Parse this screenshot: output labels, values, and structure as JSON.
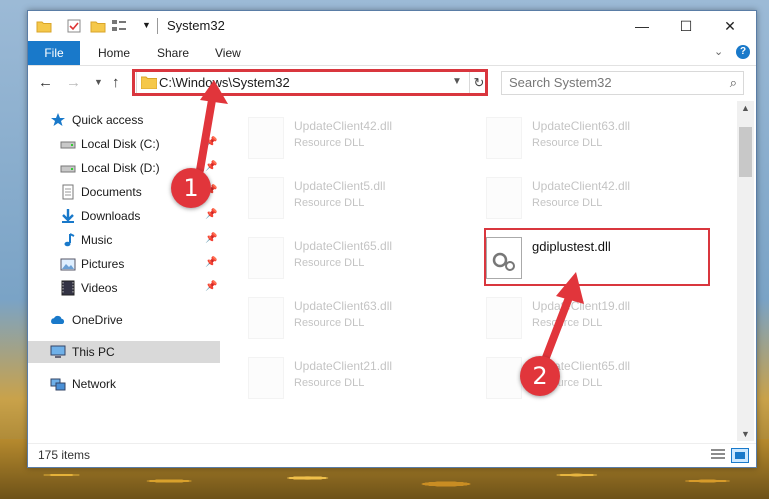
{
  "window": {
    "title": "System32"
  },
  "ribbon": {
    "tabs": [
      "File",
      "Home",
      "Share",
      "View"
    ],
    "help": "?"
  },
  "window_controls": {
    "minimize": "—",
    "maximize": "☐",
    "close": "✕"
  },
  "address": {
    "path": "C:\\Windows\\System32",
    "dropdown": "⌵",
    "refresh": "↻"
  },
  "search": {
    "placeholder": "Search System32",
    "icon": "⌕"
  },
  "nav_buttons": {
    "back": "←",
    "forward": "→",
    "recent": "⌵",
    "up": "↑"
  },
  "sidebar": {
    "items": [
      {
        "label": "Quick access",
        "icon": "star-icon",
        "pinned": false
      },
      {
        "label": "Local Disk (C:)",
        "icon": "drive-icon",
        "pinned": true
      },
      {
        "label": "Local Disk (D:)",
        "icon": "drive-icon",
        "pinned": true
      },
      {
        "label": "Documents",
        "icon": "documents-icon",
        "pinned": true
      },
      {
        "label": "Downloads",
        "icon": "download-icon",
        "pinned": true
      },
      {
        "label": "Music",
        "icon": "music-icon",
        "pinned": true
      },
      {
        "label": "Pictures",
        "icon": "pictures-icon",
        "pinned": true
      },
      {
        "label": "Videos",
        "icon": "videos-icon",
        "pinned": true
      },
      {
        "label": "OneDrive",
        "icon": "cloud-icon",
        "pinned": false
      },
      {
        "label": "This PC",
        "icon": "computer-icon",
        "pinned": false
      },
      {
        "label": "Network",
        "icon": "network-icon",
        "pinned": false
      }
    ],
    "pin_glyph": "📌"
  },
  "files": [
    {
      "name": "UpdateClient42.dll",
      "type": "Resource DLL"
    },
    {
      "name": "UpdateClient63.dll",
      "type": "Resource DLL"
    },
    {
      "name": "UpdateClient5.dll",
      "type": "Resource DLL"
    },
    {
      "name": "UpdateClient42.dll",
      "type": "Resource DLL"
    },
    {
      "name": "UpdateClient65.dll",
      "type": "Resource DLL"
    },
    {
      "name": "gdiplustest.dll",
      "type": ""
    },
    {
      "name": "UpdateClient63.dll",
      "type": "Resource DLL"
    },
    {
      "name": "UpdateClient19.dll",
      "type": "Resource DLL"
    },
    {
      "name": "UpdateClient21.dll",
      "type": "Resource DLL"
    },
    {
      "name": "UpdateClient65.dll",
      "type": "Resource DLL"
    }
  ],
  "status": {
    "item_count": "175 items"
  },
  "callouts": {
    "one": "1",
    "two": "2"
  },
  "colors": {
    "accent": "#1979ca",
    "highlight": "#d9363e",
    "selected": "#cce8ff"
  }
}
